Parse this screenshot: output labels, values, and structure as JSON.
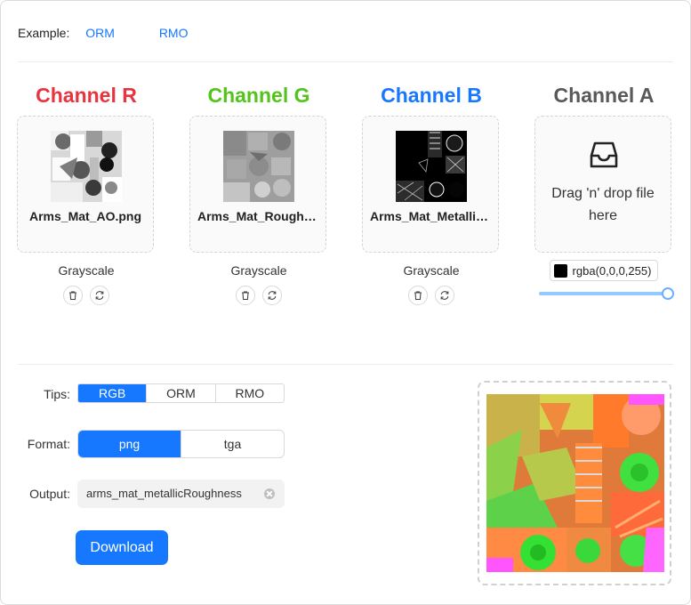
{
  "example": {
    "label": "Example:",
    "links": [
      "ORM",
      "RMO"
    ]
  },
  "channels": [
    {
      "title": "Channel R",
      "color": "#e8343f",
      "file": "Arms_Mat_AO.png",
      "mode": "Grayscale"
    },
    {
      "title": "Channel G",
      "color": "#52c41a",
      "file": "Arms_Mat_Roughness.png",
      "mode": "Grayscale"
    },
    {
      "title": "Channel B",
      "color": "#1677ff",
      "file": "Arms_Mat_Metallic.png",
      "mode": "Grayscale"
    },
    {
      "title": "Channel A",
      "color": "#595959",
      "dropText": "Drag 'n' drop file here",
      "fillValue": "rgba(0,0,0,255)",
      "fillColor": "#000000",
      "alphaLevel": 1.0
    }
  ],
  "tips": {
    "label": "Tips:",
    "options": [
      "RGB",
      "ORM",
      "RMO"
    ],
    "selected": "RGB"
  },
  "format": {
    "label": "Format:",
    "options": [
      "png",
      "tga"
    ],
    "selected": "png"
  },
  "output": {
    "label": "Output:",
    "value": "arms_mat_metallicRoughness"
  },
  "download": {
    "label": "Download"
  },
  "icons": {
    "delete": "trash-icon",
    "replace": "refresh-icon",
    "drop": "inbox-icon"
  },
  "accent": "#1677ff"
}
